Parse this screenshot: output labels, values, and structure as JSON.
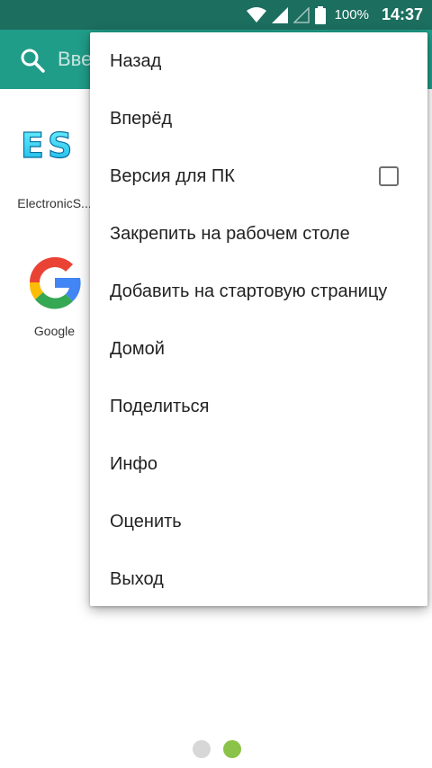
{
  "status_bar": {
    "battery_percent": "100%",
    "time": "14:37",
    "icons": [
      "wifi-icon",
      "signal-icon",
      "signal-empty-icon",
      "battery-icon"
    ]
  },
  "toolbar": {
    "search_placeholder": "Вве",
    "search_icon": "search-icon",
    "color": "#209d89"
  },
  "shortcuts": [
    {
      "label": "ElectronicS...",
      "icon": "es-logo-icon"
    },
    {
      "label": "Google",
      "icon": "google-logo-icon"
    }
  ],
  "menu": {
    "items": [
      {
        "label": "Назад"
      },
      {
        "label": "Вперёд"
      },
      {
        "label": "Версия для ПК",
        "checkbox": false
      },
      {
        "label": "Закрепить на рабочем столе"
      },
      {
        "label": "Добавить на стартовую страницу"
      },
      {
        "label": "Домой"
      },
      {
        "label": "Поделиться"
      },
      {
        "label": "Инфо"
      },
      {
        "label": "Оценить"
      },
      {
        "label": "Выход"
      }
    ]
  },
  "page_indicator": {
    "pages": 2,
    "current": 2,
    "active_color": "#8bc34a",
    "inactive_color": "#d7d7d7"
  }
}
